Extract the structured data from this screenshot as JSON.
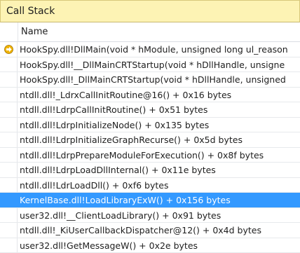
{
  "window": {
    "title": "Call Stack"
  },
  "columns": {
    "name": "Name"
  },
  "frames": [
    {
      "text": "HookSpy.dll!DllMain(void * hModule, unsigned long ul_reason",
      "current": true,
      "selected": false
    },
    {
      "text": "HookSpy.dll!__DllMainCRTStartup(void * hDllHandle, unsigne",
      "current": false,
      "selected": false
    },
    {
      "text": "HookSpy.dll!_DllMainCRTStartup(void * hDllHandle, unsigned",
      "current": false,
      "selected": false
    },
    {
      "text": "ntdll.dll!_LdrxCallInitRoutine@16()  + 0x16 bytes",
      "current": false,
      "selected": false
    },
    {
      "text": "ntdll.dll!LdrpCallInitRoutine()  + 0x51 bytes",
      "current": false,
      "selected": false
    },
    {
      "text": "ntdll.dll!LdrpInitializeNode()  + 0x135 bytes",
      "current": false,
      "selected": false
    },
    {
      "text": "ntdll.dll!LdrpInitializeGraphRecurse()  + 0x5d bytes",
      "current": false,
      "selected": false
    },
    {
      "text": "ntdll.dll!LdrpPrepareModuleForExecution()  + 0x8f bytes",
      "current": false,
      "selected": false
    },
    {
      "text": "ntdll.dll!LdrpLoadDllInternal()  + 0x11e bytes",
      "current": false,
      "selected": false
    },
    {
      "text": "ntdll.dll!LdrLoadDll()  + 0xf6 bytes",
      "current": false,
      "selected": false
    },
    {
      "text": "KernelBase.dll!LoadLibraryExW()  + 0x156 bytes",
      "current": false,
      "selected": true
    },
    {
      "text": "user32.dll!__ClientLoadLibrary()  + 0x91 bytes",
      "current": false,
      "selected": false
    },
    {
      "text": "ntdll.dll!_KiUserCallbackDispatcher@12()  + 0x4d bytes",
      "current": false,
      "selected": false
    },
    {
      "text": "user32.dll!GetMessageW()  + 0x2e bytes",
      "current": false,
      "selected": false
    }
  ],
  "colors": {
    "title_bg": "#fdf3b4",
    "selection": "#3399ff",
    "current_frame_icon": "#f0b400"
  }
}
